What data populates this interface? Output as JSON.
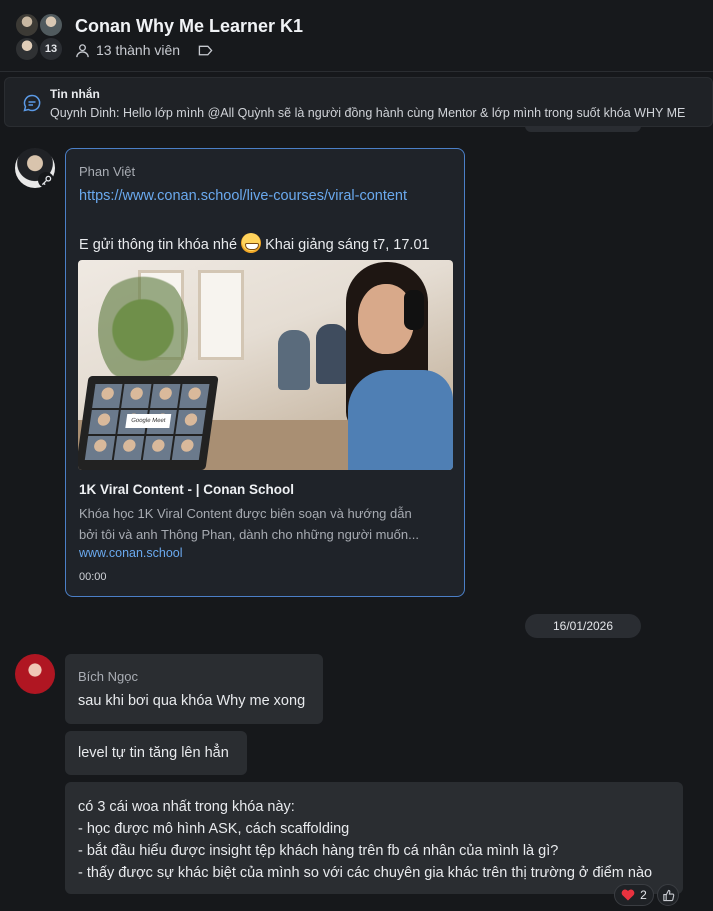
{
  "header": {
    "title": "Conan Why Me Learner K1",
    "member_count_badge": "13",
    "members_label": "13 thành viên"
  },
  "pinned": {
    "title": "Tin nhắn",
    "text": "Quynh Dinh: Hello lớp mình @All  Quỳnh sẽ là người đồng hành cùng Mentor & lớp mình trong suốt khóa WHY ME"
  },
  "message_1": {
    "sender": "Phan Việt",
    "link": "https://www.conan.school/live-courses/viral-content",
    "text_before": "E gửi thông tin khóa nhé",
    "text_after": "Khai giảng sáng t7, 17.01",
    "preview": {
      "meet_label": "Google Meet",
      "title": "1K Viral Content - | Conan School",
      "description_line1": "Khóa học 1K Viral Content được biên soạn và hướng dẫn",
      "description_line2": "bởi tôi và anh Thông Phan, dành cho những người muốn...",
      "domain": "www.conan.school"
    },
    "time": "00:00"
  },
  "date_separator": "16/01/2026",
  "message_2": {
    "sender": "Bích Ngọc",
    "bubble_1": "sau khi bơi qua khóa Why me xong",
    "bubble_2": "level tự tin tăng lên hẳn",
    "bubble_3_lines": [
      "có 3 cái woa nhất trong khóa này:",
      "- học được mô hình ASK, cách scaffolding",
      "- bắt đầu hiểu được insight tệp khách hàng trên fb cá nhân của mình là gì?",
      "- thấy được sự khác biệt của mình so với các chuyên gia khác trên thị trường ở điểm nào"
    ],
    "reaction": {
      "icon": "heart-icon",
      "count": "2"
    }
  },
  "colors": {
    "accent": "#4b7fc7",
    "link": "#6aa9ee",
    "background": "#16181b",
    "bubble": "#2a2d31"
  }
}
